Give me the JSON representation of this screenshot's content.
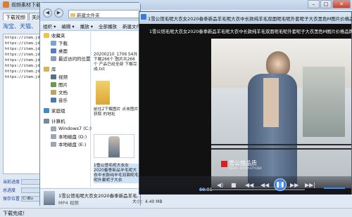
{
  "bg": {
    "title": "视频素材下载",
    "tabs": [
      "下载视频",
      "关闭"
    ],
    "banner": "淘宝、天猫、",
    "urls": [
      "https://item.jd",
      "https://item.jd",
      "https://item.jd",
      "https://item.jd",
      "https://item.jd",
      "https://item.jd",
      "https://item.jd",
      "https://item.jd"
    ],
    "labels": [
      {
        "label": "当前进度",
        "val": ""
      },
      {
        "label": "总进度",
        "val": ""
      },
      {
        "label": "保存位置",
        "val": "C:\\Bu"
      }
    ],
    "status": "下载完成！"
  },
  "explorer": {
    "address": "新建文件夹",
    "toolbar": [
      "组织 ▾",
      "编辑 ▾",
      "播放 ▾",
      "全部播放",
      "新建文件夹"
    ],
    "nav": [
      {
        "label": "收藏夹",
        "sub": false,
        "color": "#f2c14e"
      },
      {
        "label": "下载",
        "sub": true,
        "color": "#7ca3d6"
      },
      {
        "label": "桌面",
        "sub": true,
        "color": "#4f7fc2"
      },
      {
        "label": "最近访问的位置",
        "sub": true,
        "color": "#8a9fb7"
      },
      {
        "label": "库",
        "sub": false,
        "color": "#d6b35a"
      },
      {
        "label": "视频",
        "sub": true,
        "color": "#5a6e86"
      },
      {
        "label": "图片",
        "sub": true,
        "color": "#6a9a4e"
      },
      {
        "label": "文档",
        "sub": true,
        "color": "#b9a46a"
      },
      {
        "label": "音乐",
        "sub": true,
        "color": "#4977b0"
      },
      {
        "label": "家庭组",
        "sub": false,
        "color": "#3d8bc9"
      },
      {
        "label": "计算机",
        "sub": false,
        "color": "#7b8794"
      },
      {
        "label": "Windows7 (C:)",
        "sub": true,
        "color": "#9aa8b6"
      },
      {
        "label": "本地磁盘 (D:)",
        "sub": true,
        "color": "#9aa8b6"
      },
      {
        "label": "本地磁盘 (E:)",
        "sub": true,
        "color": "#9aa8b6"
      }
    ],
    "file1": "20200210_1706 54共下载266个 图片共266个 产品已经全部 下载完成.txt",
    "file2": "前往2下载图片 点击图片获取 的地址",
    "file3": "1雪公馆毛呢大衣女2020春季新品羊毛呢大衣中长款纯羊毛双面呢毛呢外套呢子大衣",
    "detail_title": "1雪公馆毛呢大衣女2020春季新品羊毛...",
    "detail_type": "MP4 视频",
    "detail_size": "大小：4.40 MB"
  },
  "player": {
    "title": "1雪公馆毛呢大衣女2020春季新品羊毛呢大衣中长款纯羊毛双面呢毛呢外套呢子大衣黑色M图片价格品牌报...",
    "overlay_title": "1雪公馆毛呢大衣女2020春季新品羊毛呢大衣中长款纯羊毛双面呢毛呢外套呢子大衣黑色M图片价格品牌报...",
    "watermark": "雪公馆品质",
    "watermark_sub": "WEAR · EXTRA-STYLISH",
    "time": "00:01",
    "progress": 0.05
  }
}
